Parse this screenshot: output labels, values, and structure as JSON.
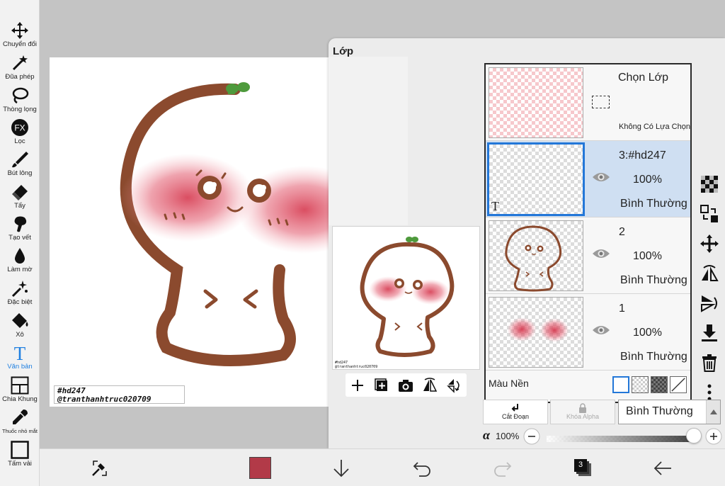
{
  "toolbar": {
    "tools": [
      {
        "label": "Chuyển đổi",
        "icon": "move-arrows-icon"
      },
      {
        "label": "Đũa phép",
        "icon": "magic-wand-icon"
      },
      {
        "label": "Thòng lọng",
        "icon": "lasso-icon"
      },
      {
        "label": "Lọc",
        "icon": "fx-filter-icon"
      },
      {
        "label": "Bút lông",
        "icon": "brush-icon"
      },
      {
        "label": "Tẩy",
        "icon": "eraser-icon"
      },
      {
        "label": "Tạo vết",
        "icon": "smudge-finger-icon"
      },
      {
        "label": "Làm mờ",
        "icon": "blur-drop-icon"
      },
      {
        "label": "Đặc biệt",
        "icon": "sparkle-icon"
      },
      {
        "label": "Xô",
        "icon": "bucket-icon"
      },
      {
        "label": "Văn bản",
        "icon": "text-t-icon"
      },
      {
        "label": "Chia Khung",
        "icon": "frame-divider-icon"
      },
      {
        "label": "Thuốc nhỏ mắt",
        "icon": "eyedropper-icon"
      },
      {
        "label": "Tấm vải",
        "icon": "canvas-icon"
      }
    ],
    "active": "Văn bản"
  },
  "canvas": {
    "signature_line1": "#hd247",
    "signature_line2": "@tranthanhtruc020709"
  },
  "layer_panel": {
    "title": "Lớp",
    "preview_tools": [
      "add-icon",
      "add-layer-icon",
      "camera-icon",
      "flip-icon",
      "rotate-icon"
    ],
    "selection_layer": {
      "title": "Chọn Lớp",
      "subtitle": "Không Có Lựa Chọn"
    },
    "layers": [
      {
        "name": "3:#hd247",
        "opacity": "100%",
        "blend": "Bình Thường",
        "selected": true,
        "type": "text",
        "type_mark": "T"
      },
      {
        "name": "2",
        "opacity": "100%",
        "blend": "Bình Thường",
        "selected": false
      },
      {
        "name": "1",
        "opacity": "100%",
        "blend": "Bình Thường",
        "selected": false
      }
    ],
    "background_label": "Màu Nền",
    "clip_label": "Cắt Đoạn",
    "alpha_lock_label": "Khóa Alpha",
    "blend_mode": "Bình Thường",
    "alpha_symbol": "α",
    "alpha_value": "100%",
    "alpha_fraction": 1.0
  },
  "bottom_bar": {
    "current_color": "#b23a48",
    "layer_count": "3"
  },
  "colors": {
    "accent": "#2377d8",
    "stroke_brown": "#8b4a2e",
    "blush": "#d9465a",
    "sprout": "#4e9a3c"
  }
}
